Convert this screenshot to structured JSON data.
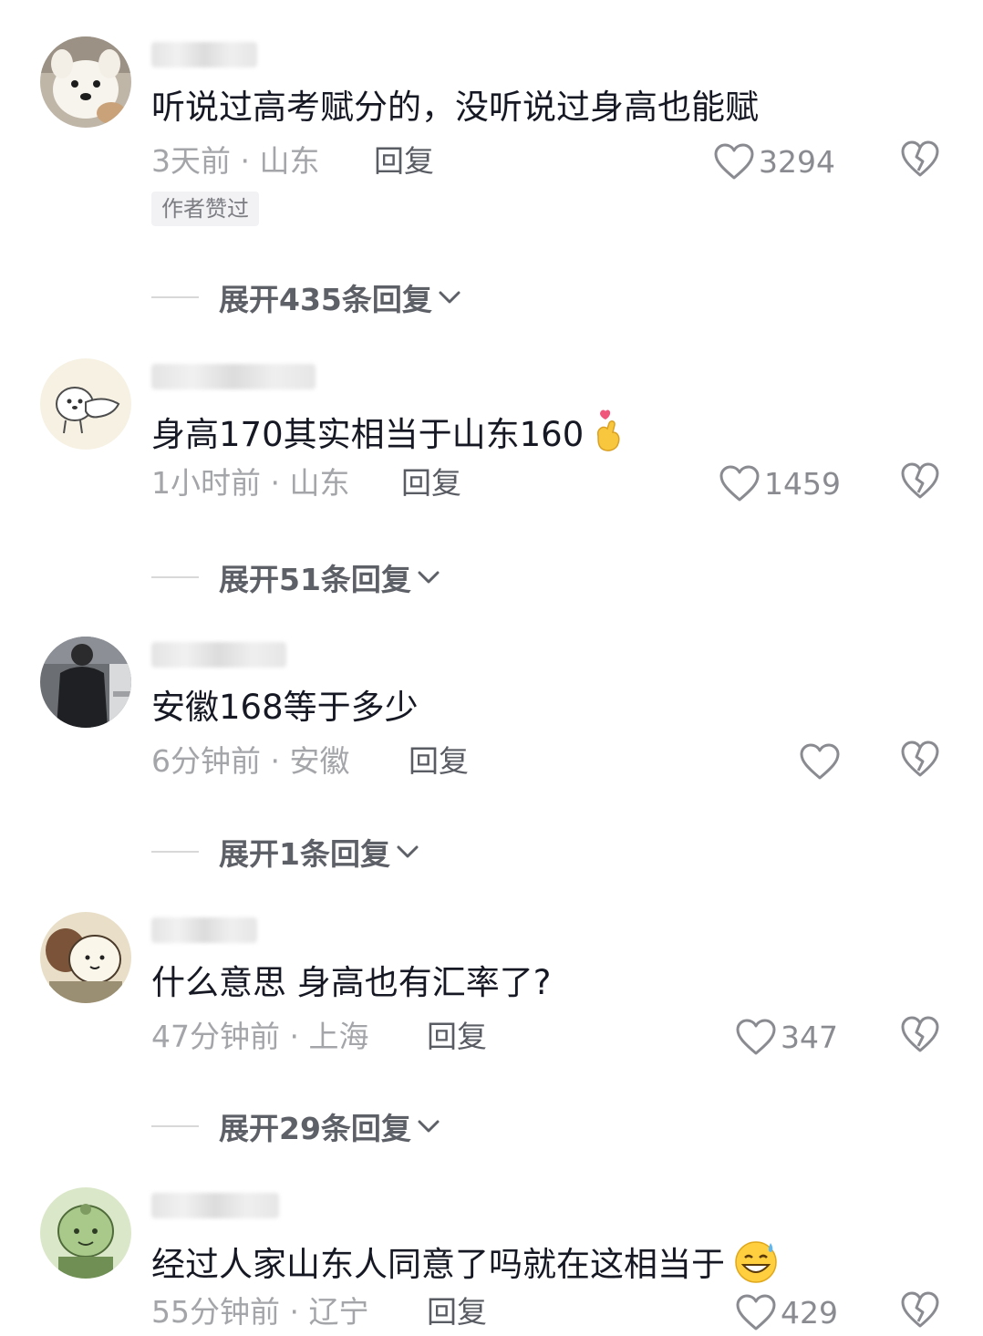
{
  "comments": [
    {
      "text": "听说过高考赋分的，没听说过身高也能赋",
      "time": "3天前",
      "location": "山东",
      "reply_label": "回复",
      "likes": "3294",
      "badge": "作者赞过",
      "expand": "展开435条回复",
      "avatar_icon": "white-dog-avatar"
    },
    {
      "text": "身高170其实相当于山东160",
      "time": "1小时前",
      "location": "山东",
      "reply_label": "回复",
      "likes": "1459",
      "expand": "展开51条回复",
      "emoji": "finger-heart-emoji",
      "avatar_icon": "cartoon-dog-avatar"
    },
    {
      "text": "安徽168等于多少",
      "time": "6分钟前",
      "location": "安徽",
      "reply_label": "回复",
      "likes": "",
      "expand": "展开1条回复",
      "avatar_icon": "person-photo-avatar"
    },
    {
      "text": "什么意思 身高也有汇率了?",
      "time": "47分钟前",
      "location": "上海",
      "reply_label": "回复",
      "likes": "347",
      "expand": "展开29条回复",
      "avatar_icon": "cartoon-cat-avatar"
    },
    {
      "text": "经过人家山东人同意了吗就在这相当于",
      "time": "55分钟前",
      "location": "辽宁",
      "reply_label": "回复",
      "likes": "429",
      "emoji": "grinning-sweat-emoji",
      "avatar_icon": "green-cartoon-avatar"
    }
  ],
  "colors": {
    "text": "#161823",
    "meta": "#a4a5a9",
    "icon": "#8a8b91"
  }
}
